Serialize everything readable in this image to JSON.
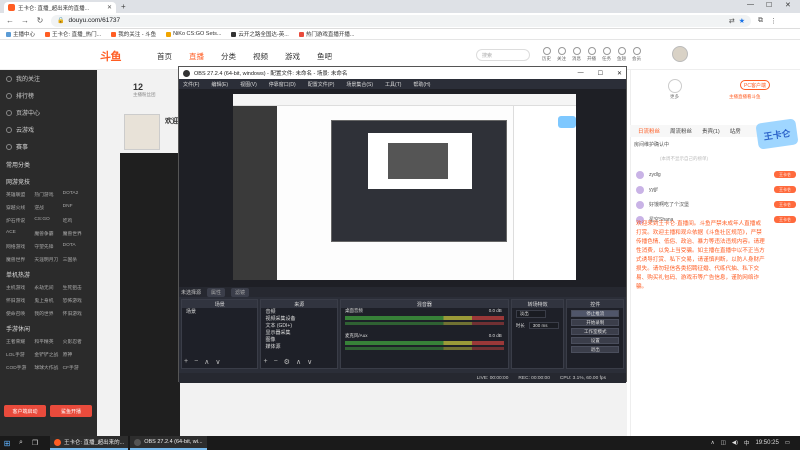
{
  "browser": {
    "tab_title": "王卡仑: 直播_超出来的直播...",
    "url": "douyu.com/61737",
    "bookmarks": [
      "主播中心",
      "王卡仑: 直播_热门...",
      "我的关注 - 斗鱼",
      "NiKo CS:GO Sets...",
      "云开之路全国达-英...",
      "热门游戏直播开播..."
    ]
  },
  "douyu": {
    "logo": "斗鱼",
    "nav": [
      "首页",
      "直播",
      "分类",
      "视频",
      "游戏",
      "鱼吧"
    ],
    "search_placeholder": "搜索",
    "header_icons": [
      "历史",
      "关注",
      "消息",
      "开播",
      "任务",
      "鱼翅",
      "会员"
    ],
    "room_count": "12",
    "room_sub": "主播粉丝团",
    "welcome": "欢迎",
    "sidebar": {
      "items": [
        "我的关注",
        "排行榜",
        "页游中心",
        "云游戏",
        "赛事"
      ],
      "section_common": "常用分类",
      "section_hot": "网游竞技",
      "hot_grid": [
        "英雄联盟",
        "热门游戏",
        "DOTA2",
        "穿越火线",
        "逆战",
        "DNF",
        "炉石传说",
        "CS:GO",
        "吃鸡",
        "ACE",
        "魔兽争霸",
        "魔兽世界",
        "网络游戏",
        "守望先锋",
        "DOTA",
        "魔兽世界",
        "天涯明月刀",
        "三国杀"
      ],
      "section_single": "单机热游",
      "single_grid": [
        "主机游戏",
        "永劫无间",
        "生死狙击",
        "怀旧游戏",
        "鬼上身机",
        "恐怖游戏",
        "使命召唤",
        "我的世界",
        "怀旧游戏"
      ],
      "section_mobile": "手游休闲",
      "mobile_grid": [
        "王者荣耀",
        "和平精英",
        "火影忍者",
        "LOL手游",
        "金铲铲之战",
        "原神",
        "COD手游",
        "球球大作战",
        "CF手游"
      ],
      "btn_left": "客户端启动",
      "btn_right": "鲨鱼开播"
    },
    "right": {
      "pc_button": "PC客户端",
      "pc_sub": "主播直播看斗鱼",
      "more": "更多",
      "tabs": [
        "日流粉丝",
        "周流粉丝",
        "贵宾(1)",
        "站房"
      ],
      "pinned": "房间维护确认中",
      "note": "(本周不显示自己的榜单)",
      "rank": [
        {
          "name": "zydlg",
          "tag": "王卡仑"
        },
        {
          "name": "yyjjf",
          "tag": "王卡仑"
        },
        {
          "name": "好饿啊吃了个汉堡",
          "tag": "王卡仑"
        },
        {
          "name": "星空Shana",
          "tag": "王卡仑"
        }
      ],
      "badge_art": "王卡仑",
      "welcome_msg": "欢迎来到王卡仑·直播间。斗鱼严禁未成年人直播或打赏。欢迎主播和观众依据《斗鱼社区规范》，严禁传播色情、低俗、政治、暴力等违法违规内容。请理性消费，以免上当受骗。如主播在直播中以不正当方式诱导打赏、私下交易，请谨慎判断，以防人身财产损失。请勿轻信各类招聘征婚、代练代抽、私下交易、购买礼包码、游戏币等广告信息，谨防网络诈骗。"
    }
  },
  "obs": {
    "title": "OBS 27.2.4 (64-bit, windows) - 配置文件: 未命名 - 场景: 未命名",
    "menu": [
      "文件(F)",
      "编辑(E)",
      "视图(V)",
      "停靠窗口(D)",
      "配置文件(P)",
      "场景集合(S)",
      "工具(T)",
      "帮助(H)"
    ],
    "src_bar": {
      "label": "未选择源",
      "props": "属性",
      "filters": "滤镜"
    },
    "docks": {
      "scenes_title": "场景",
      "scenes": [
        "场景"
      ],
      "sources_title": "来源",
      "sources": [
        "音频",
        "视频采集设备",
        "文本 (GDI+)",
        "显示器采集",
        "图像",
        "媒体源"
      ],
      "mixer_title": "混音器",
      "mixer": [
        {
          "name": "桌面音频",
          "db": "0.0 dB"
        },
        {
          "name": "麦克风/Aux",
          "db": "0.0 dB"
        }
      ],
      "transitions_title": "转场特效",
      "transition_type": "淡出",
      "duration_label": "时长",
      "duration": "300 ms",
      "controls_title": "控件",
      "controls": [
        "停止推流",
        "开始录制",
        "工作室模式",
        "设置",
        "退出"
      ]
    },
    "status": {
      "live": "LIVE: 00:00:00",
      "rec": "REC: 00:00:00",
      "cpu": "CPU: 3.1%, 60.00 fps"
    }
  },
  "taskbar": {
    "items": [
      "王卡仑: 直播_超出来的...",
      "OBS 27.2.4 (64-bit, wi..."
    ],
    "lang": "中",
    "time": "19:50:25"
  }
}
